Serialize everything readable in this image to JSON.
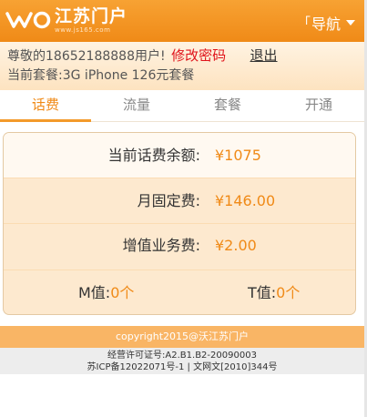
{
  "header": {
    "logo_text": "江苏门户",
    "logo_url": "www.js165.com",
    "nav_label": "导航",
    "brand_color": "#f08a17"
  },
  "user": {
    "greeting_prefix": "尊敬的",
    "phone": "18652188888",
    "greeting_suffix": "用户!",
    "change_password": "修改密码",
    "logout": "退出",
    "plan_label": "当前套餐:",
    "plan_name": "3G iPhone 126元套餐"
  },
  "tabs": [
    {
      "label": "话费",
      "active": true
    },
    {
      "label": "流量",
      "active": false
    },
    {
      "label": "套餐",
      "active": false
    },
    {
      "label": "开通",
      "active": false
    }
  ],
  "fees": {
    "balance_label": "当前话费余额:",
    "balance_value": "¥1075",
    "fixed_label": "月固定费:",
    "fixed_value": "¥146.00",
    "vas_label": "增值业务费:",
    "vas_value": "¥2.00",
    "m_label": "M值:",
    "m_value": "0个",
    "t_label": "T值:",
    "t_value": "0个"
  },
  "footer": {
    "copyright": "copyright2015@沃江苏门户",
    "license_line1": "经营许可证号:A2.B1.B2-20090003",
    "license_line2": "苏ICP备12022071号-1 | 文网文[2010]344号"
  }
}
